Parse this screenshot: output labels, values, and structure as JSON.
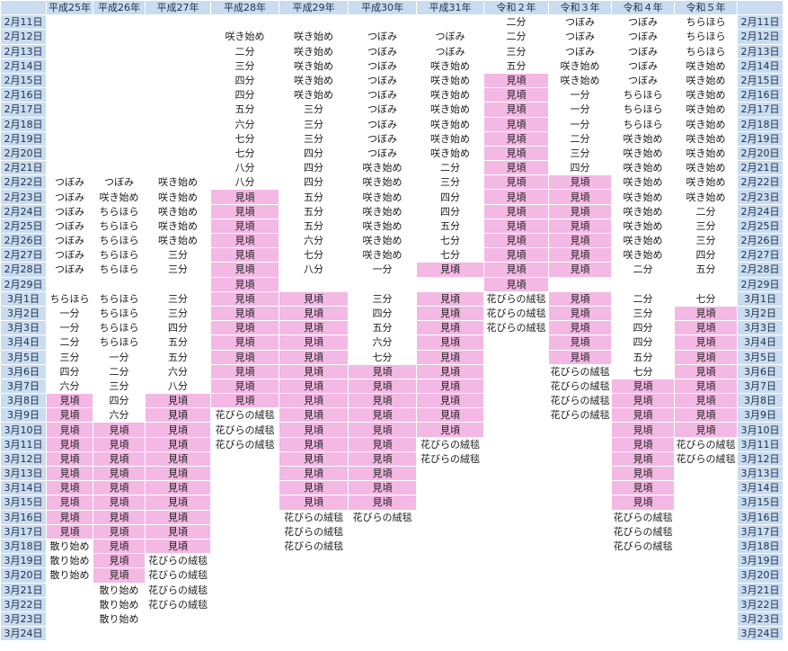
{
  "headers": [
    "",
    "平成25年",
    "平成26年",
    "平成27年",
    "平成28年",
    "平成29年",
    "平成30年",
    "平成31年",
    "令和２年",
    "令和３年",
    "令和４年",
    "令和５年",
    ""
  ],
  "colors": {
    "date_bg": "#c9dcf0",
    "peak_bg": "#f4b8e4",
    "text": "#1c1c1c"
  },
  "rows": [
    {
      "date": "2月11日",
      "c": [
        "",
        "",
        "",
        "",
        "",
        "",
        "",
        "二分",
        "つぼみ",
        "つぼみ",
        "ちらほら"
      ],
      "p": [
        0,
        0,
        0,
        0,
        0,
        0,
        0,
        0,
        0,
        0,
        0
      ]
    },
    {
      "date": "2月12日",
      "c": [
        "",
        "",
        "",
        "咲き始め",
        "咲き始め",
        "つぼみ",
        "つぼみ",
        "二分",
        "つぼみ",
        "つぼみ",
        "ちらほら"
      ],
      "p": [
        0,
        0,
        0,
        0,
        0,
        0,
        0,
        0,
        0,
        0,
        0
      ]
    },
    {
      "date": "2月13日",
      "c": [
        "",
        "",
        "",
        "二分",
        "咲き始め",
        "つぼみ",
        "つぼみ",
        "三分",
        "つぼみ",
        "つぼみ",
        "ちらほら"
      ],
      "p": [
        0,
        0,
        0,
        0,
        0,
        0,
        0,
        0,
        0,
        0,
        0
      ]
    },
    {
      "date": "2月14日",
      "c": [
        "",
        "",
        "",
        "三分",
        "咲き始め",
        "つぼみ",
        "咲き始め",
        "五分",
        "咲き始め",
        "つぼみ",
        "咲き始め"
      ],
      "p": [
        0,
        0,
        0,
        0,
        0,
        0,
        0,
        0,
        0,
        0,
        0
      ]
    },
    {
      "date": "2月15日",
      "c": [
        "",
        "",
        "",
        "四分",
        "咲き始め",
        "つぼみ",
        "咲き始め",
        "見頃",
        "咲き始め",
        "つぼみ",
        "咲き始め"
      ],
      "p": [
        0,
        0,
        0,
        0,
        0,
        0,
        0,
        1,
        0,
        0,
        0
      ]
    },
    {
      "date": "2月16日",
      "c": [
        "",
        "",
        "",
        "四分",
        "咲き始め",
        "つぼみ",
        "咲き始め",
        "見頃",
        "一分",
        "ちらほら",
        "咲き始め"
      ],
      "p": [
        0,
        0,
        0,
        0,
        0,
        0,
        0,
        1,
        0,
        0,
        0
      ]
    },
    {
      "date": "2月17日",
      "c": [
        "",
        "",
        "",
        "五分",
        "三分",
        "つぼみ",
        "咲き始め",
        "見頃",
        "一分",
        "ちらほら",
        "咲き始め"
      ],
      "p": [
        0,
        0,
        0,
        0,
        0,
        0,
        0,
        1,
        0,
        0,
        0
      ]
    },
    {
      "date": "2月18日",
      "c": [
        "",
        "",
        "",
        "六分",
        "三分",
        "つぼみ",
        "咲き始め",
        "見頃",
        "一分",
        "ちらほら",
        "咲き始め"
      ],
      "p": [
        0,
        0,
        0,
        0,
        0,
        0,
        0,
        1,
        0,
        0,
        0
      ]
    },
    {
      "date": "2月19日",
      "c": [
        "",
        "",
        "",
        "七分",
        "三分",
        "つぼみ",
        "咲き始め",
        "見頃",
        "二分",
        "咲き始め",
        "咲き始め"
      ],
      "p": [
        0,
        0,
        0,
        0,
        0,
        0,
        0,
        1,
        0,
        0,
        0
      ]
    },
    {
      "date": "2月20日",
      "c": [
        "",
        "",
        "",
        "七分",
        "四分",
        "つぼみ",
        "咲き始め",
        "見頃",
        "三分",
        "咲き始め",
        "咲き始め"
      ],
      "p": [
        0,
        0,
        0,
        0,
        0,
        0,
        0,
        1,
        0,
        0,
        0
      ]
    },
    {
      "date": "2月21日",
      "c": [
        "",
        "",
        "",
        "八分",
        "四分",
        "咲き始め",
        "二分",
        "見頃",
        "四分",
        "咲き始め",
        "咲き始め"
      ],
      "p": [
        0,
        0,
        0,
        0,
        0,
        0,
        0,
        1,
        0,
        0,
        0
      ]
    },
    {
      "date": "2月22日",
      "c": [
        "つぼみ",
        "つぼみ",
        "咲き始め",
        "八分",
        "四分",
        "咲き始め",
        "三分",
        "見頃",
        "見頃",
        "咲き始め",
        "咲き始め"
      ],
      "p": [
        0,
        0,
        0,
        0,
        0,
        0,
        0,
        1,
        1,
        0,
        0
      ]
    },
    {
      "date": "2月23日",
      "c": [
        "つぼみ",
        "咲き始め",
        "咲き始め",
        "見頃",
        "五分",
        "咲き始め",
        "四分",
        "見頃",
        "見頃",
        "咲き始め",
        "咲き始め"
      ],
      "p": [
        0,
        0,
        0,
        1,
        0,
        0,
        0,
        1,
        1,
        0,
        0
      ]
    },
    {
      "date": "2月24日",
      "c": [
        "つぼみ",
        "ちらほら",
        "咲き始め",
        "見頃",
        "五分",
        "咲き始め",
        "四分",
        "見頃",
        "見頃",
        "咲き始め",
        "二分"
      ],
      "p": [
        0,
        0,
        0,
        1,
        0,
        0,
        0,
        1,
        1,
        0,
        0
      ]
    },
    {
      "date": "2月25日",
      "c": [
        "つぼみ",
        "ちらほら",
        "咲き始め",
        "見頃",
        "五分",
        "咲き始め",
        "五分",
        "見頃",
        "見頃",
        "咲き始め",
        "三分"
      ],
      "p": [
        0,
        0,
        0,
        1,
        0,
        0,
        0,
        1,
        1,
        0,
        0
      ]
    },
    {
      "date": "2月26日",
      "c": [
        "つぼみ",
        "ちらほら",
        "咲き始め",
        "見頃",
        "六分",
        "咲き始め",
        "七分",
        "見頃",
        "見頃",
        "咲き始め",
        "三分"
      ],
      "p": [
        0,
        0,
        0,
        1,
        0,
        0,
        0,
        1,
        1,
        0,
        0
      ]
    },
    {
      "date": "2月27日",
      "c": [
        "つぼみ",
        "ちらほら",
        "三分",
        "見頃",
        "七分",
        "咲き始め",
        "七分",
        "見頃",
        "見頃",
        "咲き始め",
        "四分"
      ],
      "p": [
        0,
        0,
        0,
        1,
        0,
        0,
        0,
        1,
        1,
        0,
        0
      ]
    },
    {
      "date": "2月28日",
      "c": [
        "つぼみ",
        "ちらほら",
        "三分",
        "見頃",
        "八分",
        "一分",
        "見頃",
        "見頃",
        "見頃",
        "二分",
        "五分"
      ],
      "p": [
        0,
        0,
        0,
        1,
        0,
        0,
        1,
        1,
        1,
        0,
        0
      ]
    },
    {
      "date": "2月29日",
      "c": [
        "",
        "",
        "",
        "見頃",
        "",
        "",
        "",
        "見頃",
        "",
        "",
        ""
      ],
      "p": [
        0,
        0,
        0,
        1,
        0,
        0,
        0,
        1,
        0,
        0,
        0
      ]
    },
    {
      "date": "3月1日",
      "c": [
        "ちらほら",
        "ちらほら",
        "三分",
        "見頃",
        "見頃",
        "三分",
        "見頃",
        "花びらの絨毯",
        "見頃",
        "二分",
        "七分"
      ],
      "p": [
        0,
        0,
        0,
        1,
        1,
        0,
        1,
        0,
        1,
        0,
        0
      ]
    },
    {
      "date": "3月2日",
      "c": [
        "一分",
        "ちらほら",
        "三分",
        "見頃",
        "見頃",
        "四分",
        "見頃",
        "花びらの絨毯",
        "見頃",
        "三分",
        "見頃"
      ],
      "p": [
        0,
        0,
        0,
        1,
        1,
        0,
        1,
        0,
        1,
        0,
        1
      ]
    },
    {
      "date": "3月3日",
      "c": [
        "一分",
        "ちらほら",
        "四分",
        "見頃",
        "見頃",
        "五分",
        "見頃",
        "花びらの絨毯",
        "見頃",
        "四分",
        "見頃"
      ],
      "p": [
        0,
        0,
        0,
        1,
        1,
        0,
        1,
        0,
        1,
        0,
        1
      ]
    },
    {
      "date": "3月4日",
      "c": [
        "二分",
        "ちらほら",
        "五分",
        "見頃",
        "見頃",
        "六分",
        "見頃",
        "",
        "見頃",
        "四分",
        "見頃"
      ],
      "p": [
        0,
        0,
        0,
        1,
        1,
        0,
        1,
        0,
        1,
        0,
        1
      ]
    },
    {
      "date": "3月5日",
      "c": [
        "三分",
        "一分",
        "五分",
        "見頃",
        "見頃",
        "七分",
        "見頃",
        "",
        "見頃",
        "五分",
        "見頃"
      ],
      "p": [
        0,
        0,
        0,
        1,
        1,
        0,
        1,
        0,
        1,
        0,
        1
      ]
    },
    {
      "date": "3月6日",
      "c": [
        "四分",
        "二分",
        "六分",
        "見頃",
        "見頃",
        "見頃",
        "見頃",
        "",
        "花びらの絨毯",
        "七分",
        "見頃"
      ],
      "p": [
        0,
        0,
        0,
        1,
        1,
        1,
        1,
        0,
        0,
        0,
        1
      ]
    },
    {
      "date": "3月7日",
      "c": [
        "六分",
        "三分",
        "八分",
        "見頃",
        "見頃",
        "見頃",
        "見頃",
        "",
        "花びらの絨毯",
        "見頃",
        "見頃"
      ],
      "p": [
        0,
        0,
        0,
        1,
        1,
        1,
        1,
        0,
        0,
        1,
        1
      ]
    },
    {
      "date": "3月8日",
      "c": [
        "見頃",
        "四分",
        "見頃",
        "見頃",
        "見頃",
        "見頃",
        "見頃",
        "",
        "花びらの絨毯",
        "見頃",
        "見頃"
      ],
      "p": [
        1,
        0,
        1,
        1,
        1,
        1,
        1,
        0,
        0,
        1,
        1
      ]
    },
    {
      "date": "3月9日",
      "c": [
        "見頃",
        "六分",
        "見頃",
        "花びらの絨毯",
        "見頃",
        "見頃",
        "見頃",
        "",
        "花びらの絨毯",
        "見頃",
        "見頃"
      ],
      "p": [
        1,
        0,
        1,
        0,
        1,
        1,
        1,
        0,
        0,
        1,
        1
      ]
    },
    {
      "date": "3月10日",
      "c": [
        "見頃",
        "見頃",
        "見頃",
        "花びらの絨毯",
        "見頃",
        "見頃",
        "見頃",
        "",
        "",
        "見頃",
        "見頃"
      ],
      "p": [
        1,
        1,
        1,
        0,
        1,
        1,
        1,
        0,
        0,
        1,
        1
      ]
    },
    {
      "date": "3月11日",
      "c": [
        "見頃",
        "見頃",
        "見頃",
        "花びらの絨毯",
        "見頃",
        "見頃",
        "花びらの絨毯",
        "",
        "",
        "見頃",
        "花びらの絨毯"
      ],
      "p": [
        1,
        1,
        1,
        0,
        1,
        1,
        0,
        0,
        0,
        1,
        0
      ]
    },
    {
      "date": "3月12日",
      "c": [
        "見頃",
        "見頃",
        "見頃",
        "",
        "見頃",
        "見頃",
        "花びらの絨毯",
        "",
        "",
        "見頃",
        "花びらの絨毯"
      ],
      "p": [
        1,
        1,
        1,
        0,
        1,
        1,
        0,
        0,
        0,
        1,
        0
      ]
    },
    {
      "date": "3月13日",
      "c": [
        "見頃",
        "見頃",
        "見頃",
        "",
        "見頃",
        "見頃",
        "",
        "",
        "",
        "見頃",
        ""
      ],
      "p": [
        1,
        1,
        1,
        0,
        1,
        1,
        0,
        0,
        0,
        1,
        0
      ]
    },
    {
      "date": "3月14日",
      "c": [
        "見頃",
        "見頃",
        "見頃",
        "",
        "見頃",
        "見頃",
        "",
        "",
        "",
        "見頃",
        ""
      ],
      "p": [
        1,
        1,
        1,
        0,
        1,
        1,
        0,
        0,
        0,
        1,
        0
      ]
    },
    {
      "date": "3月15日",
      "c": [
        "見頃",
        "見頃",
        "見頃",
        "",
        "見頃",
        "見頃",
        "",
        "",
        "",
        "見頃",
        ""
      ],
      "p": [
        1,
        1,
        1,
        0,
        1,
        1,
        0,
        0,
        0,
        1,
        0
      ]
    },
    {
      "date": "3月16日",
      "c": [
        "見頃",
        "見頃",
        "見頃",
        "",
        "花びらの絨毯",
        "花びらの絨毯",
        "",
        "",
        "",
        "花びらの絨毯",
        ""
      ],
      "p": [
        1,
        1,
        1,
        0,
        0,
        0,
        0,
        0,
        0,
        0,
        0
      ]
    },
    {
      "date": "3月17日",
      "c": [
        "見頃",
        "見頃",
        "見頃",
        "",
        "花びらの絨毯",
        "",
        "",
        "",
        "",
        "花びらの絨毯",
        ""
      ],
      "p": [
        1,
        1,
        1,
        0,
        0,
        0,
        0,
        0,
        0,
        0,
        0
      ]
    },
    {
      "date": "3月18日",
      "c": [
        "散り始め",
        "見頃",
        "見頃",
        "",
        "花びらの絨毯",
        "",
        "",
        "",
        "",
        "花びらの絨毯",
        ""
      ],
      "p": [
        0,
        1,
        1,
        0,
        0,
        0,
        0,
        0,
        0,
        0,
        0
      ]
    },
    {
      "date": "3月19日",
      "c": [
        "散り始め",
        "見頃",
        "花びらの絨毯",
        "",
        "",
        "",
        "",
        "",
        "",
        "",
        ""
      ],
      "p": [
        0,
        1,
        0,
        0,
        0,
        0,
        0,
        0,
        0,
        0,
        0
      ]
    },
    {
      "date": "3月20日",
      "c": [
        "散り始め",
        "見頃",
        "花びらの絨毯",
        "",
        "",
        "",
        "",
        "",
        "",
        "",
        ""
      ],
      "p": [
        0,
        1,
        0,
        0,
        0,
        0,
        0,
        0,
        0,
        0,
        0
      ]
    },
    {
      "date": "3月21日",
      "c": [
        "",
        "散り始め",
        "花びらの絨毯",
        "",
        "",
        "",
        "",
        "",
        "",
        "",
        ""
      ],
      "p": [
        0,
        0,
        0,
        0,
        0,
        0,
        0,
        0,
        0,
        0,
        0
      ]
    },
    {
      "date": "3月22日",
      "c": [
        "",
        "散り始め",
        "花びらの絨毯",
        "",
        "",
        "",
        "",
        "",
        "",
        "",
        ""
      ],
      "p": [
        0,
        0,
        0,
        0,
        0,
        0,
        0,
        0,
        0,
        0,
        0
      ]
    },
    {
      "date": "3月23日",
      "c": [
        "",
        "散り始め",
        "",
        "",
        "",
        "",
        "",
        "",
        "",
        "",
        ""
      ],
      "p": [
        0,
        0,
        0,
        0,
        0,
        0,
        0,
        0,
        0,
        0,
        0
      ]
    },
    {
      "date": "3月24日",
      "c": [
        "",
        "",
        "",
        "",
        "",
        "",
        "",
        "",
        "",
        "",
        ""
      ],
      "p": [
        0,
        0,
        0,
        0,
        0,
        0,
        0,
        0,
        0,
        0,
        0
      ]
    }
  ]
}
